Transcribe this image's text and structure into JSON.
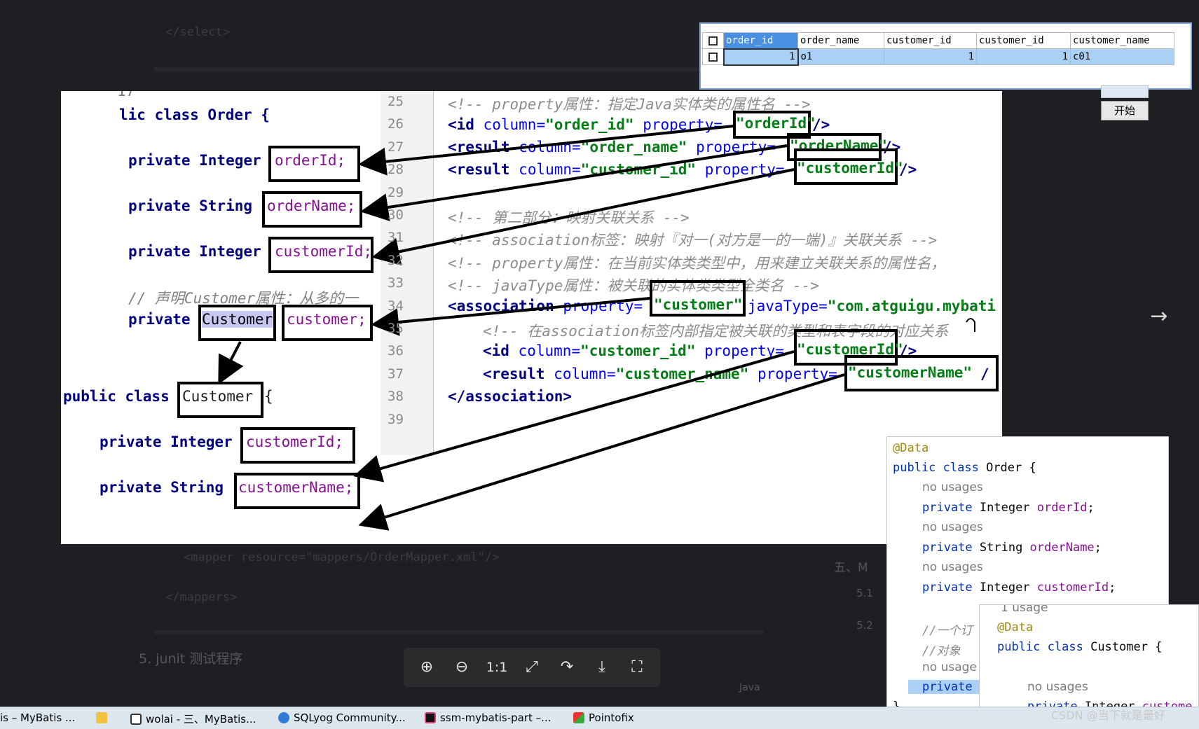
{
  "background_doc": {
    "select_close": "</select>",
    "mapper_line": "<mapper resource=\"mappers/OrderMapper.xml\"/>",
    "mappers_close": "</mappers>",
    "junit_heading": "5. junit 测试程序",
    "toc_item": "五、M",
    "toc_sub1": "5.1",
    "toc_sub2": "5.2",
    "lang_label": "Java"
  },
  "query_result": {
    "columns": [
      "order_id",
      "order_name",
      "customer_id",
      "customer_id",
      "customer_name"
    ],
    "rows": [
      [
        "1",
        "o1",
        "1",
        "1",
        "c01"
      ]
    ],
    "start_button": "开始"
  },
  "diagram": {
    "java_order": {
      "line_no_top": "17",
      "class_decl": "lic class Order {",
      "f1_type": "private Integer",
      "f1_name": "orderId;",
      "f2_type": "private String",
      "f2_name": "orderName;",
      "f3_type": "private Integer",
      "f3_name": "customerId;",
      "comment": "// 声明Customer属性：从多的一",
      "f4_mod": "private",
      "f4_type": "Customer",
      "f4_name": "customer;"
    },
    "java_customer": {
      "class_kw": "public class",
      "class_name": "Customer",
      "brace": "{",
      "f1_type": "private Integer",
      "f1_name": "customerId;",
      "f2_type": "private String",
      "f2_name": "customerName;"
    },
    "line_numbers": [
      "25",
      "26",
      "27",
      "28",
      "29",
      "30",
      "31",
      "32",
      "33",
      "34",
      "35",
      "36",
      "37",
      "38",
      "39"
    ],
    "xml_lines": {
      "l25": "<!-- property属性：指定Java实体类的属性名 -->",
      "l30": "<!-- 第二部分：映射关联关系 -->",
      "l31": "<!-- association标签：映射『对一(对方是一的一端)』关联关系 -->",
      "l32": "<!-- property属性：在当前实体类类型中，用来建立关联关系的属性名，",
      "l33": "<!-- javaType属性：被关联的实体类类型全类名 -->",
      "l35": "<!-- 在association标签内部指定被关联的类型和表字段的对应关系"
    },
    "xml_values": {
      "order_id_col": "\"order_id\"",
      "order_id_prop": "\"orderId\"",
      "order_name_col": "\"order_name\"",
      "order_name_prop": "\"orderName\"",
      "customer_id_col": "\"customer_id\"",
      "customer_id_prop": "\"customerId\"",
      "assoc_prop": "\"customer\"",
      "java_type": "\"com.atguigu.mybati",
      "inner_id_col": "\"customer_id\"",
      "inner_id_prop": "\"customerId\"",
      "inner_name_col": "\"customer_name\"",
      "inner_name_prop": "\"customerName\""
    }
  },
  "popup_order": {
    "annotation": "@Data",
    "class_decl": "public class Order {",
    "hint": "no usages",
    "f1": "private Integer orderId;",
    "f2": "private String orderName;",
    "f3": "private Integer customerId;",
    "c1": "//一个订",
    "c2": "//对象 ",
    "hint_short": "no usage",
    "f4": "private",
    "close": "}"
  },
  "popup_customer": {
    "usage": "1 usage",
    "annotation": "@Data",
    "class_decl": "public class Customer {",
    "hint": "no usages",
    "f1": "private Integer custome"
  },
  "zoom_toolbar": [
    "zoom-in",
    "zoom-out",
    "1:1",
    "fit",
    "rotate",
    "download",
    "fullscreen"
  ],
  "zoom_labels": {
    "one_to_one": "1:1"
  },
  "taskbar": {
    "items": [
      "is – MyBatis ...",
      "wolai - 三、MyBatis...",
      "SQLyog Community...",
      "ssm-mybatis-part –...",
      "Pointofix"
    ]
  },
  "watermark": "CSDN @当下就是最好",
  "colors": {
    "highlight": "#c7c7f2",
    "keyword": "#000080",
    "string": "#067d17",
    "selection": "#aad0f5"
  }
}
